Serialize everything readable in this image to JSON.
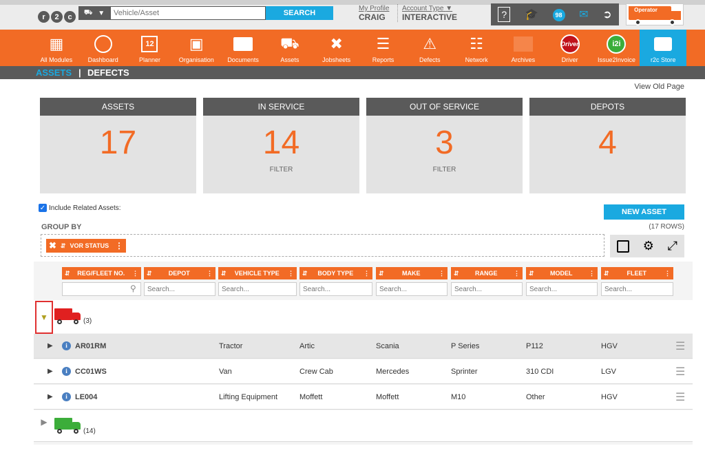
{
  "header": {
    "logo_letters": [
      "r",
      "2",
      "c"
    ],
    "search_placeholder": "Vehicle/Asset",
    "search_button": "SEARCH",
    "profile_link": "My Profile",
    "profile_name": "CRAIG",
    "account_link": "Account Type",
    "account_value": "INTERACTIVE",
    "notification_count": "98",
    "operator_label": "Operator"
  },
  "nav": {
    "items": [
      {
        "label": "All Modules",
        "icon": "grid-icon"
      },
      {
        "label": "Dashboard",
        "icon": "gauge-icon"
      },
      {
        "label": "Planner",
        "icon": "calendar-icon",
        "badge": "12"
      },
      {
        "label": "Organisation",
        "icon": "building-icon"
      },
      {
        "label": "Documents",
        "icon": "folder-icon"
      },
      {
        "label": "Assets",
        "icon": "truck-icon"
      },
      {
        "label": "Jobsheets",
        "icon": "tools-icon"
      },
      {
        "label": "Reports",
        "icon": "clipboard-icon"
      },
      {
        "label": "Defects",
        "icon": "warning-icon"
      },
      {
        "label": "Network",
        "icon": "address-book-icon"
      },
      {
        "label": "Archives",
        "icon": "archive-icon"
      },
      {
        "label": "Driver",
        "icon": "driver-logo-icon",
        "logo_text": "Driver"
      },
      {
        "label": "Issue2Invoice",
        "icon": "i2i-logo-icon",
        "logo_text": "i2i"
      },
      {
        "label": "r2c Store",
        "icon": "briefcase-icon"
      }
    ]
  },
  "subnav": {
    "assets": "ASSETS",
    "separator": "|",
    "defects": "DEFECTS"
  },
  "view_old_page": "View Old Page",
  "tiles": [
    {
      "title": "ASSETS",
      "value": "17",
      "filter": ""
    },
    {
      "title": "IN SERVICE",
      "value": "14",
      "filter": "FILTER"
    },
    {
      "title": "OUT OF SERVICE",
      "value": "3",
      "filter": "FILTER"
    },
    {
      "title": "DEPOTS",
      "value": "4",
      "filter": ""
    }
  ],
  "include_related": "Include Related Assets:",
  "new_asset_button": "NEW ASSET",
  "group_by_label": "GROUP BY",
  "rows_count": "(17 ROWS)",
  "group_chip": "VOR STATUS",
  "columns": [
    {
      "label": "REG/FLEET NO.",
      "placeholder": ""
    },
    {
      "label": "DEPOT",
      "placeholder": "Search..."
    },
    {
      "label": "VEHICLE TYPE",
      "placeholder": "Search..."
    },
    {
      "label": "BODY TYPE",
      "placeholder": "Search..."
    },
    {
      "label": "MAKE",
      "placeholder": "Search..."
    },
    {
      "label": "RANGE",
      "placeholder": "Search..."
    },
    {
      "label": "MODEL",
      "placeholder": "Search..."
    },
    {
      "label": "FLEET",
      "placeholder": "Search..."
    }
  ],
  "groups": [
    {
      "count": "(3)",
      "color": "#e02020",
      "expanded": true
    },
    {
      "count": "(14)",
      "color": "#3cad3a",
      "expanded": false
    }
  ],
  "rows": [
    {
      "reg": "AR01RM",
      "vehicle_type": "Tractor",
      "body_type": "Artic",
      "make": "Scania",
      "range": "P Series",
      "model": "P112",
      "fleet": "HGV"
    },
    {
      "reg": "CC01WS",
      "vehicle_type": "Van",
      "body_type": "Crew Cab",
      "make": "Mercedes",
      "range": "Sprinter",
      "model": "310 CDI",
      "fleet": "LGV"
    },
    {
      "reg": "LE004",
      "vehicle_type": "Lifting Equipment",
      "body_type": "Moffett",
      "make": "Moffett",
      "range": "M10",
      "model": "Other",
      "fleet": "HGV"
    }
  ]
}
